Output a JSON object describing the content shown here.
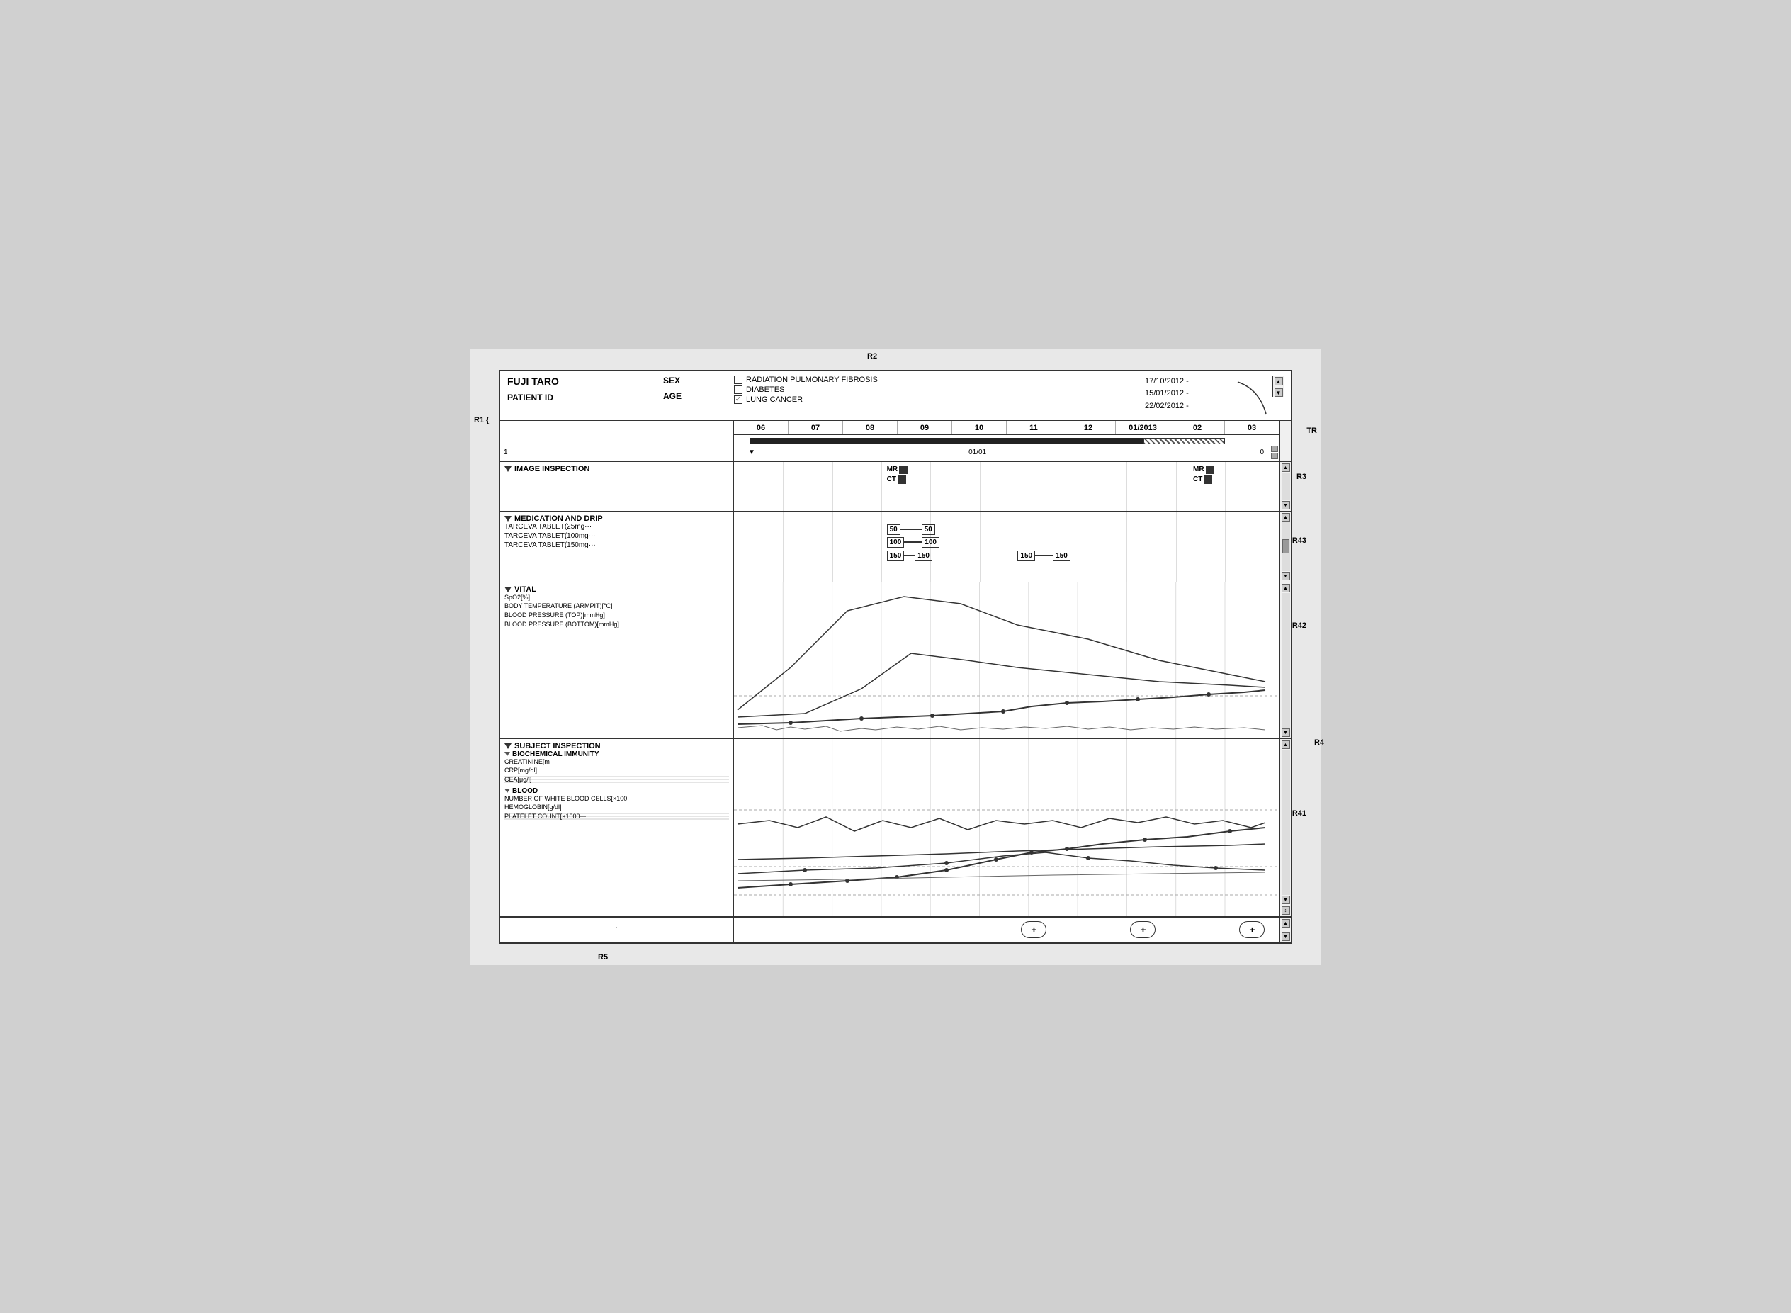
{
  "patient": {
    "name": "FUJI TARO",
    "id_label": "PATIENT ID",
    "sex_label": "SEX",
    "age_label": "AGE",
    "conditions": [
      {
        "label": "RADIATION PULMONARY FIBROSIS",
        "checked": false
      },
      {
        "label": "DIABETES",
        "checked": false
      },
      {
        "label": "LUNG CANCER",
        "checked": true
      }
    ],
    "dates": [
      "17/10/2012 -",
      "15/01/2012 -",
      "22/02/2012 -"
    ]
  },
  "timeline": {
    "months": [
      "06",
      "07",
      "08",
      "09",
      "10",
      "11",
      "12",
      "01/2013",
      "02",
      "03"
    ]
  },
  "sections": {
    "image_inspection": {
      "title": "IMAGE INSPECTION",
      "markers_left": [
        {
          "type": "MR"
        },
        {
          "type": "CT"
        }
      ],
      "markers_right": [
        {
          "type": "MR"
        },
        {
          "type": "CT"
        }
      ]
    },
    "medication": {
      "title": "MEDICATION AND DRIP",
      "items": [
        "TARCEVA TABLET(25mg···",
        "TARCEVA TABLET(100mg···",
        "TARCEVA TABLET(150mg···"
      ],
      "bars": [
        {
          "label": "50",
          "label2": "50"
        },
        {
          "label": "100",
          "label2": "100"
        },
        {
          "label": "150",
          "label2": "150"
        },
        {
          "label": "150",
          "label2": "150"
        }
      ]
    },
    "vital": {
      "title": "VITAL",
      "items": [
        "SpO2[%]",
        "BODY TEMPERATURE (ARMPIT)[°C]",
        "BLOOD PRESSURE (TOP)[mmHg]",
        "BLOOD PRESSURE (BOTTOM)[mmHg]"
      ]
    },
    "subject_inspection": {
      "title": "SUBJECT INSPECTION",
      "biochemical": {
        "title": "BIOCHEMICAL IMMUNITY",
        "items": [
          "CREATININE[m···",
          "CRP[mg/dl]",
          "CEA[μg/l]"
        ]
      },
      "blood": {
        "title": "BLOOD",
        "items": [
          "NUMBER OF WHITE BLOOD CELLS[×100···",
          "HEMOGLOBIN[g/dl]",
          "PLATELET COUNT[×1000···"
        ]
      }
    }
  },
  "reference_labels": {
    "r1": "R1",
    "r2": "R2",
    "r3": "R3",
    "r43": "R43",
    "r42": "R42",
    "r4": "R4",
    "r41": "R41",
    "r5": "R5",
    "tr": "TR"
  },
  "buttons": {
    "plus": "(+)"
  },
  "timeline2": {
    "start": "1",
    "mid": "01/01",
    "end": "0"
  }
}
